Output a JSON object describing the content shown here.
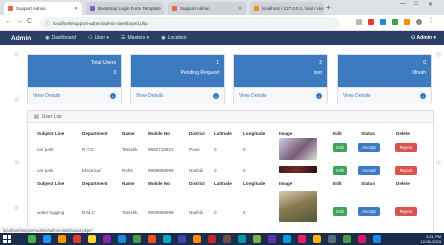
{
  "browser": {
    "tabs": [
      {
        "title": "Support Admin",
        "active": true,
        "color": "#e8683b"
      },
      {
        "title": "Bootstrap Login Form Template",
        "active": false,
        "color": "#7b5fbf"
      },
      {
        "title": "Support Admin",
        "active": false,
        "color": "#e8683b"
      },
      {
        "title": "localhost / 127.0.0.1 / test / reo",
        "active": false,
        "color": "#f29111"
      }
    ],
    "address": "localhost/support-admin/admin-dashboard.php",
    "nav_back": "←",
    "nav_forward": "→",
    "nav_reload": "C",
    "new_tab": "+",
    "window_controls": [
      "—",
      "□",
      "✕"
    ]
  },
  "navbar": {
    "brand": "Admin",
    "links": [
      {
        "icon": "dashboard-icon",
        "glyph": "◉",
        "label": "Dashboard"
      },
      {
        "icon": "user-icon",
        "glyph": "⚇",
        "label": "User ▾"
      },
      {
        "icon": "masters-icon",
        "glyph": "☰",
        "label": "Masters ▾"
      },
      {
        "icon": "location-icon",
        "glyph": "◉",
        "label": "Location"
      }
    ],
    "admin_menu": "⚇ Admin ▾"
  },
  "cards": [
    {
      "label": "Total Users",
      "value": "3",
      "link": "View Details"
    },
    {
      "label": "Pending Request",
      "value": "1",
      "link": "View Details"
    },
    {
      "label": "test",
      "value": "2",
      "link": "View Details"
    },
    {
      "label": "0fresh",
      "value": "0",
      "link": "View Details"
    }
  ],
  "panel": {
    "title": "User List",
    "columns": [
      "Subject Line",
      "Department",
      "Name",
      "Mobile No",
      "District",
      "Latitude",
      "Longitude",
      "Image",
      "Edit",
      "Status",
      "Delete"
    ],
    "rows": [
      {
        "subject": "car park",
        "department": "R.T.O",
        "name": "Tanishk",
        "mobile": "9960718821",
        "district": "Pune",
        "latitude": "0",
        "longitude": "0",
        "image_tone": "#7a5a7a"
      },
      {
        "subject": "car park",
        "department": "Electrical",
        "name": "Rohit",
        "mobile": "9999999999",
        "district": "Nashik",
        "latitude": "0",
        "longitude": "0",
        "image_tone": "#6d2a2a"
      },
      {
        "subject": "water logging",
        "department": "B.M.C",
        "name": "Tanishk",
        "mobile": "9999999999",
        "district": "Nashik",
        "latitude": "0",
        "longitude": "0",
        "image_tone": "#8a7a52"
      }
    ],
    "buttons": {
      "edit": "Edit",
      "accept": "Accept",
      "reject": "Reject"
    }
  },
  "status_url": "localhost/support-admin/admin-dashboard.php#",
  "taskbar": {
    "time": "3:21 PM",
    "date": "12-06-2023",
    "apps": [
      "#4caf50",
      "#2196f3",
      "#ff9800",
      "#e53935",
      "#fdd835",
      "#8e24aa",
      "#1e88e5",
      "#43a047",
      "#f4511e",
      "#00acc1",
      "#3949ab",
      "#fb8c00",
      "#c62828",
      "#6d4c41",
      "#0097a7",
      "#7cb342",
      "#5e35b1",
      "#039be5",
      "#e91e63",
      "#ffb300",
      "#546e7a",
      "#43a047",
      "#d81b60",
      "#1e88e5"
    ]
  },
  "colors": {
    "navbar": "#2b3e66",
    "card_header": "#3c7bbf",
    "edit": "#3aa45b",
    "accept": "#3d78c5",
    "reject": "#d9534f"
  }
}
